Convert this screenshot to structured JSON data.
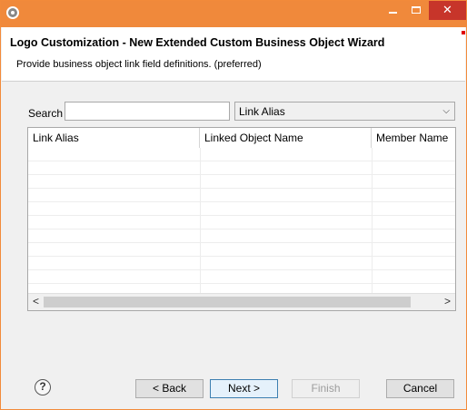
{
  "window": {
    "title_icon": "eclipse-app-icon",
    "accent_color": "#f0893b",
    "close_color": "#c7352a"
  },
  "header": {
    "title": "Logo Customization - New Extended Custom Business Object Wizard",
    "description": "Provide business object link field definitions. (preferred)"
  },
  "search": {
    "label": "Search",
    "value": "",
    "filter_selected": "Link Alias"
  },
  "table": {
    "columns": [
      "Link Alias",
      "Linked Object Name",
      "Member Name"
    ],
    "rows": []
  },
  "buttons": {
    "back": "< Back",
    "next": "Next >",
    "finish": "Finish",
    "cancel": "Cancel",
    "help": "?"
  }
}
